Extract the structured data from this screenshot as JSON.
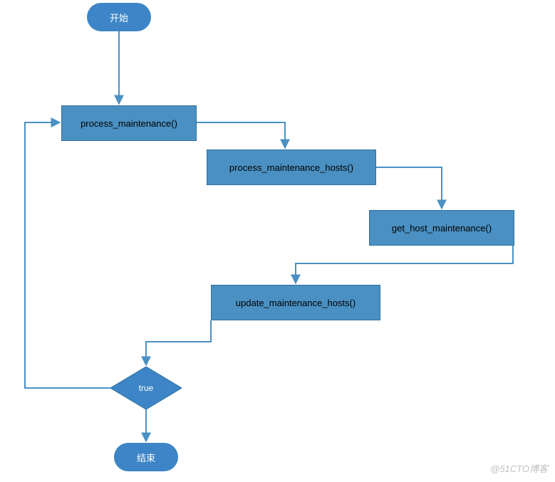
{
  "flow": {
    "start": "开始",
    "step1": "process_maintenance()",
    "step2": "process_maintenance_hosts()",
    "step3": "get_host_maintenance()",
    "step4": "update_maintenance_hosts()",
    "decision": "true",
    "end": "结束"
  },
  "watermark": "@51CTO博客",
  "colors": {
    "node_fill": "#4a90c2",
    "node_border": "#2f6fa0",
    "terminator_fill": "#3d85c6",
    "connector": "#4a90c2"
  }
}
